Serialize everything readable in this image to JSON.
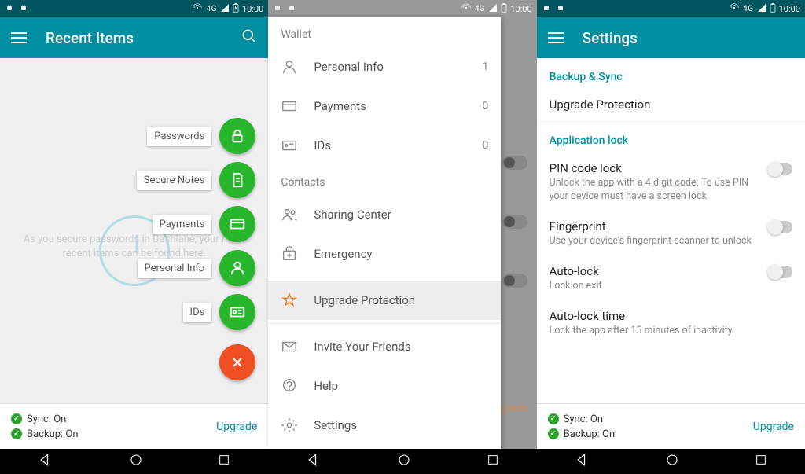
{
  "status": {
    "time": "10:00",
    "network": "4G"
  },
  "screen1": {
    "title": "Recent Items",
    "hint": "As you secure passwords in Dashlane, your most recent items can be found here.",
    "fab": {
      "passwords": "Passwords",
      "notes": "Secure Notes",
      "payments": "Payments",
      "personal": "Personal Info",
      "ids": "IDs"
    },
    "footer": {
      "sync": "Sync: On",
      "backup": "Backup: On",
      "upgrade": "Upgrade"
    }
  },
  "screen2": {
    "wallet_header": "Wallet",
    "contacts_header": "Contacts",
    "items": {
      "personal": {
        "label": "Personal Info",
        "count": "1"
      },
      "payments": {
        "label": "Payments",
        "count": "0"
      },
      "ids": {
        "label": "IDs",
        "count": "0"
      },
      "sharing": {
        "label": "Sharing Center"
      },
      "emergency": {
        "label": "Emergency"
      },
      "upgrade": {
        "label": "Upgrade Protection"
      },
      "invite": {
        "label": "Invite Your Friends"
      },
      "help": {
        "label": "Help"
      },
      "settings": {
        "label": "Settings"
      }
    },
    "behind_upgrade": "pgrade"
  },
  "screen3": {
    "title": "Settings",
    "sections": {
      "backup_sync": "Backup & Sync",
      "app_lock": "Application lock"
    },
    "items": {
      "upgrade_protection": {
        "title": "Upgrade Protection"
      },
      "pin": {
        "title": "PIN code lock",
        "sub": "Unlock the app with a 4 digit code. To use PIN your device must have a screen lock"
      },
      "fingerprint": {
        "title": "Fingerprint",
        "sub": "Use your device's fingerprint scanner to unlock"
      },
      "autolock": {
        "title": "Auto-lock",
        "sub": "Lock on exit"
      },
      "autolock_time": {
        "title": "Auto-lock time",
        "sub": "Lock the app after 15 minutes of inactivity"
      }
    },
    "footer": {
      "sync": "Sync: On",
      "backup": "Backup: On",
      "upgrade": "Upgrade"
    }
  }
}
